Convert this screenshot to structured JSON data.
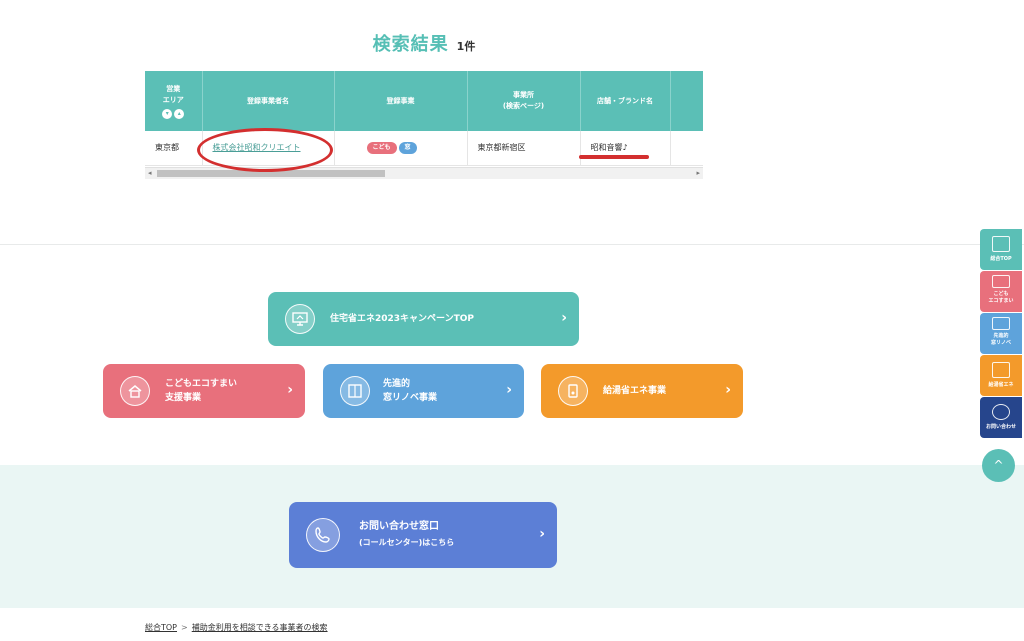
{
  "results": {
    "title": "検索結果",
    "count": "1件"
  },
  "table": {
    "headers": [
      "営業\nエリア",
      "登録事業者名",
      "登録事業",
      "事業所\n(検索ページ)",
      "店舗・ブランド名",
      ""
    ],
    "rows": [
      {
        "area": "東京都",
        "company": "株式会社昭和クリエイト",
        "tags": [
          "こども",
          "窓"
        ],
        "office": "東京都新宿区",
        "brand": "昭和音響♪"
      }
    ]
  },
  "buttons": {
    "top_label": "住宅省エネ2023キャンペーンTOP",
    "kodomo_label_1": "こどもエコすまい",
    "kodomo_label_2": "支援事業",
    "mado_label_1": "先進的",
    "mado_label_2": "窓リノベ事業",
    "kyutou_label": "給湯省エネ事業",
    "contact_label_1": "お問い合わせ窓口",
    "contact_label_2": "(コールセンター)はこちら",
    "arrow": "›"
  },
  "breadcrumb": {
    "home": "総合TOP",
    "sep": ">",
    "current": "補助金利用を相談できる事業者の検索"
  },
  "side_nav": {
    "items": [
      "総合TOP",
      "こども\nエコすまい",
      "先進的\n窓リノベ",
      "給湯省エネ",
      "お問い合わせ"
    ],
    "totop": "^"
  },
  "icons": {
    "top": "monitor-icon",
    "kodomo": "house-icon",
    "mado": "window-icon",
    "kyutou": "water-heater-icon",
    "contact": "phone-icon"
  },
  "colors": {
    "teal": "#5bbfb6",
    "pink": "#e8707c",
    "blue": "#5ea3db",
    "orange": "#f39a2b",
    "navy": "#26458c",
    "contact_blue": "#5c7fd6",
    "annotation_red": "#d32f2f"
  }
}
